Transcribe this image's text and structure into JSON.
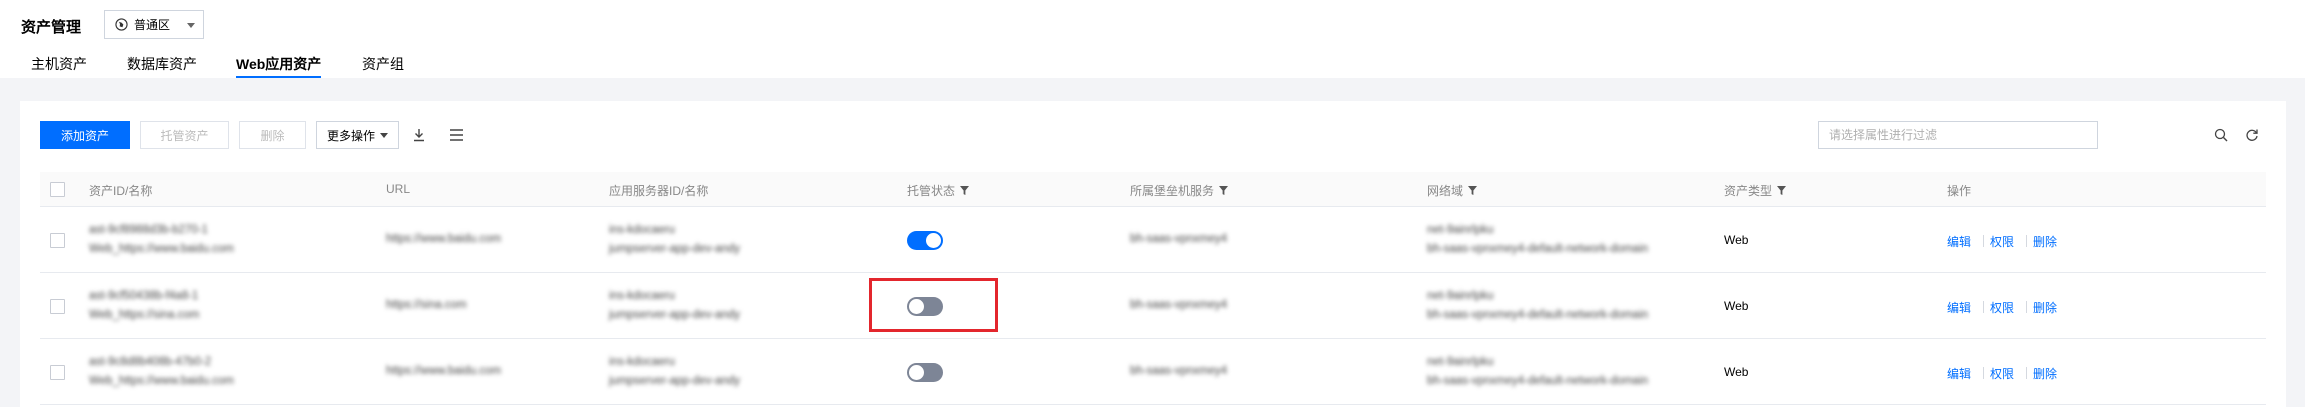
{
  "header": {
    "title": "资产管理",
    "region": "普通区"
  },
  "tabs": [
    {
      "label": "主机资产",
      "active": false
    },
    {
      "label": "数据库资产",
      "active": false
    },
    {
      "label": "Web应用资产",
      "active": true
    },
    {
      "label": "资产组",
      "active": false
    }
  ],
  "toolbar": {
    "add_label": "添加资产",
    "host_label": "托管资产",
    "delete_label": "删除",
    "more_label": "更多操作",
    "download_icon": "download-icon",
    "columns_icon": "list-settings-icon",
    "filter_placeholder": "请选择属性进行过滤",
    "search_icon": "search-icon",
    "refresh_icon": "refresh-icon"
  },
  "table": {
    "columns": {
      "id_name": "资产ID/名称",
      "url": "URL",
      "app_server": "应用服务器ID/名称",
      "hosting_status": "托管状态",
      "bastion": "所属堡垒机服务",
      "network": "网络域",
      "asset_type": "资产类型",
      "actions": "操作"
    },
    "rows": [
      {
        "id": "ast-9cf8988d3b-b270-1",
        "name": "Web_https://www.baidu.com",
        "url": "https://www.baidu.com",
        "server_id": "ins-kdocaeru",
        "server_name": "jumpserver-app-dev-andy",
        "hosted": true,
        "bastion": "bh-saas-vpnxmey4",
        "network_id": "net-9ainrlpku",
        "network_name": "bh-saas-vpnxmey4-default-network-domain",
        "type": "Web",
        "actions": [
          "编辑",
          "权限",
          "删除"
        ]
      },
      {
        "id": "ast-9cf50438b-f4a8-1",
        "name": "Web_https://sina.com",
        "url": "https://sina.com",
        "server_id": "ins-kdocaeru",
        "server_name": "jumpserver-app-dev-andy",
        "hosted": false,
        "bastion": "bh-saas-vpnxmey4",
        "network_id": "net-9ainrlpku",
        "network_name": "bh-saas-vpnxmey4-default-network-domain",
        "type": "Web",
        "actions": [
          "编辑",
          "权限",
          "删除"
        ]
      },
      {
        "id": "ast-9c8d8b408b-47b0-2",
        "name": "Web_https://www.baidu.com",
        "url": "https://www.baidu.com",
        "server_id": "ins-kdocaeru",
        "server_name": "jumpserver-app-dev-andy",
        "hosted": false,
        "bastion": "bh-saas-vpnxmey4",
        "network_id": "net-9ainrlpku",
        "network_name": "bh-saas-vpnxmey4-default-network-domain",
        "type": "Web",
        "actions": [
          "编辑",
          "权限",
          "删除"
        ]
      }
    ]
  },
  "colors": {
    "accent": "#006eff",
    "toggle_off": "#7d8596",
    "highlight": "#e3262d"
  }
}
